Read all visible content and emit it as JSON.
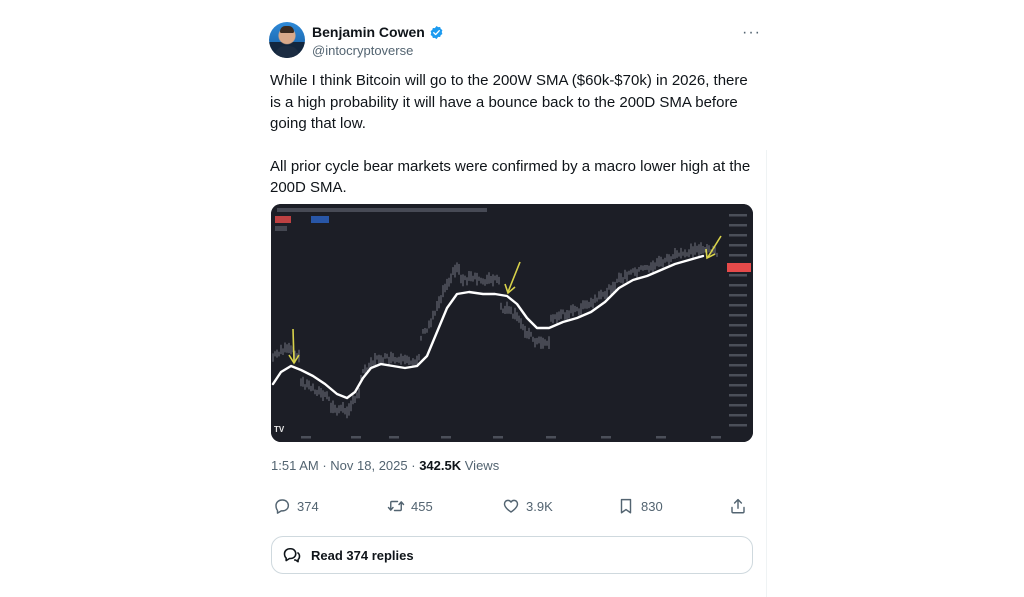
{
  "author": {
    "display_name": "Benjamin Cowen",
    "handle": "@intocryptoverse",
    "verified": true
  },
  "tweet": {
    "paragraphs": [
      "While I think Bitcoin will go to the 200W SMA ($60k-$70k) in 2026, there is a high probability it will have a bounce back to the 200D SMA before going that low.",
      "All prior cycle bear markets were confirmed by a macro lower high at the 200D SMA."
    ],
    "time": "1:51 AM",
    "date": "Nov 18, 2025",
    "views_count": "342.5K",
    "views_label": "Views"
  },
  "actions": {
    "replies": "374",
    "reposts": "455",
    "likes": "3.9K",
    "bookmarks": "830"
  },
  "read_replies_label": "Read 374 replies",
  "icons": {
    "more": "more-icon",
    "reply": "reply-icon",
    "repost": "repost-icon",
    "like": "like-icon",
    "bookmark": "bookmark-icon",
    "share": "share-icon",
    "verified": "verified-badge-icon"
  },
  "colors": {
    "verified_blue": "#1d9bf0",
    "text_secondary": "#536471",
    "chart_background": "#1c1e26",
    "sma_line": "#ffffff",
    "arrow_yellow": "#d8d24a",
    "price_tag": "#e64a4a"
  }
}
